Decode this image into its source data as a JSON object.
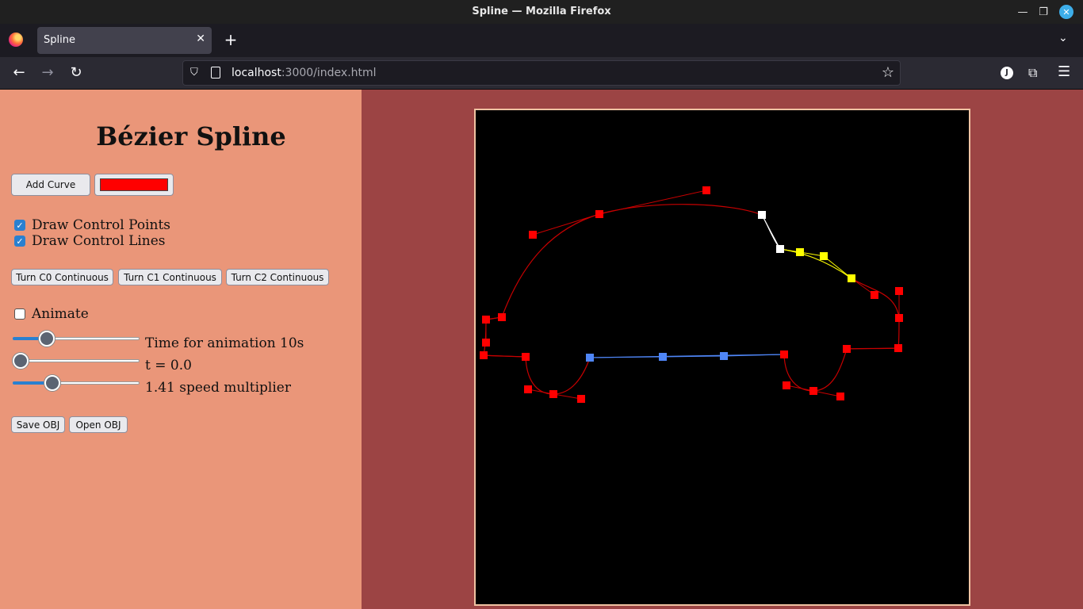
{
  "window": {
    "title": "Spline — Mozilla Firefox"
  },
  "tabs": [
    {
      "title": "Spline"
    }
  ],
  "address_bar": {
    "host": "localhost",
    "rest": ":3000/index.html"
  },
  "account_initial": "J",
  "panel": {
    "title": "Bézier Spline",
    "add_curve_label": "Add Curve",
    "curve_color": "#ff0000",
    "draw_control_points": {
      "label": "Draw Control Points",
      "checked": true
    },
    "draw_control_lines": {
      "label": "Draw Control Lines",
      "checked": true
    },
    "c0_label": "Turn C0 Continuous",
    "c1_label": "Turn C1 Continuous",
    "c2_label": "Turn C2 Continuous",
    "animate": {
      "label": "Animate",
      "checked": false
    },
    "time_slider": {
      "label": "Time for animation 10s",
      "level": 0.27
    },
    "t_slider": {
      "label": "t = 0.0",
      "level": 0.0
    },
    "speed_slider": {
      "label": "1.41 speed multiplier",
      "level": 0.31
    },
    "save_label": "Save OBJ",
    "open_label": "Open OBJ"
  },
  "colors": {
    "curve_red": "#c80000",
    "point_red": "#ff0000",
    "selected_white": "#ffffff",
    "selected_yellow": "#ffff00",
    "selected_blue": "#4f86f7"
  }
}
